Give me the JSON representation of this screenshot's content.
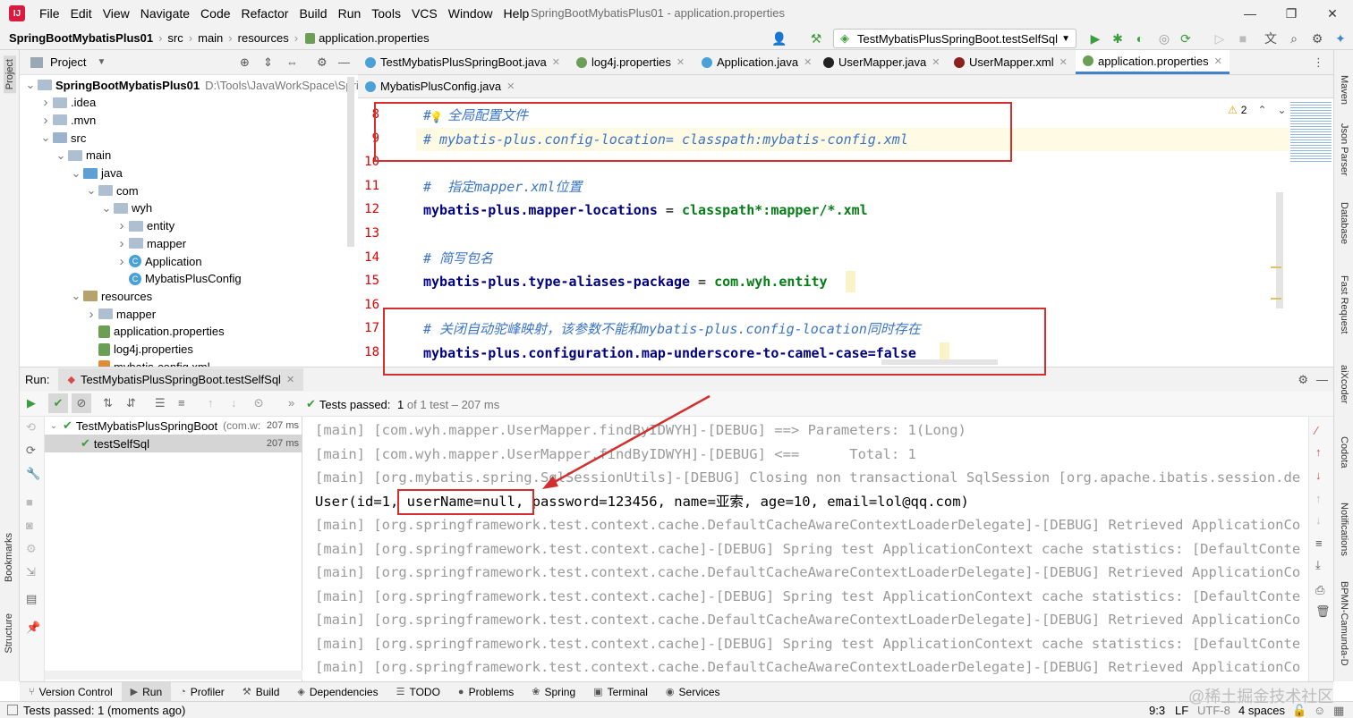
{
  "app": {
    "logo": "IJ",
    "window_title": "SpringBootMybatisPlus01 - application.properties",
    "menu": [
      "File",
      "Edit",
      "View",
      "Navigate",
      "Code",
      "Refactor",
      "Build",
      "Run",
      "Tools",
      "VCS",
      "Window",
      "Help"
    ]
  },
  "breadcrumb": [
    "SpringBootMybatisPlus01",
    "src",
    "main",
    "resources",
    "application.properties"
  ],
  "run_config": "TestMybatisPlusSpringBoot.testSelfSql",
  "project_panel": {
    "title": "Project",
    "tree": [
      {
        "label": "SpringBootMybatisPlus01",
        "extra": "D:\\Tools\\JavaWorkSpace\\Sprin",
        "type": "module",
        "depth": 0,
        "arrow": "down"
      },
      {
        "label": ".idea",
        "type": "folder",
        "depth": 1,
        "arrow": "right"
      },
      {
        "label": ".mvn",
        "type": "folder",
        "depth": 1,
        "arrow": "right"
      },
      {
        "label": "src",
        "type": "src",
        "depth": 1,
        "arrow": "down"
      },
      {
        "label": "main",
        "type": "folder",
        "depth": 2,
        "arrow": "down"
      },
      {
        "label": "java",
        "type": "java",
        "depth": 3,
        "arrow": "down"
      },
      {
        "label": "com",
        "type": "folder",
        "depth": 4,
        "arrow": "down"
      },
      {
        "label": "wyh",
        "type": "folder",
        "depth": 5,
        "arrow": "down"
      },
      {
        "label": "entity",
        "type": "folder",
        "depth": 6,
        "arrow": "right"
      },
      {
        "label": "mapper",
        "type": "folder",
        "depth": 6,
        "arrow": "right"
      },
      {
        "label": "Application",
        "type": "class",
        "depth": 6,
        "arrow": "right"
      },
      {
        "label": "MybatisPlusConfig",
        "type": "class",
        "depth": 6,
        "arrow": ""
      },
      {
        "label": "resources",
        "type": "res",
        "depth": 3,
        "arrow": "down"
      },
      {
        "label": "mapper",
        "type": "folder",
        "depth": 4,
        "arrow": "right"
      },
      {
        "label": "application.properties",
        "type": "prop",
        "depth": 4,
        "arrow": ""
      },
      {
        "label": "log4j.properties",
        "type": "prop",
        "depth": 4,
        "arrow": ""
      },
      {
        "label": "mybatis-config.xml",
        "type": "xml",
        "depth": 4,
        "arrow": ""
      }
    ]
  },
  "editor_tabs_row1": [
    "TestMybatisPlusSpringBoot.java",
    "log4j.properties",
    "Application.java",
    "UserMapper.java",
    "UserMapper.xml",
    "application.properties"
  ],
  "editor_tabs_row2": [
    "MybatisPlusConfig.java"
  ],
  "editor": {
    "warning_count": "2",
    "lines": [
      {
        "no": "8",
        "parts": [
          {
            "t": "#  全局配置文件",
            "c": "cm"
          }
        ]
      },
      {
        "no": "9",
        "parts": [
          {
            "t": "# mybatis-plus.config-location= classpath:mybatis-config.xml",
            "c": "cm"
          }
        ]
      },
      {
        "no": "10",
        "parts": []
      },
      {
        "no": "11",
        "parts": [
          {
            "t": "#  指定mapper.xml位置",
            "c": "cm"
          }
        ]
      },
      {
        "no": "12",
        "parts": [
          {
            "t": "mybatis-plus.mapper-locations",
            "c": "key"
          },
          {
            "t": " = ",
            "c": ""
          },
          {
            "t": "classpath*:mapper/*.xml",
            "c": "val"
          }
        ]
      },
      {
        "no": "13",
        "parts": []
      },
      {
        "no": "14",
        "parts": [
          {
            "t": "# 简写包名",
            "c": "cm"
          }
        ]
      },
      {
        "no": "15",
        "parts": [
          {
            "t": "mybatis-plus.type-aliases-package",
            "c": "key"
          },
          {
            "t": " = ",
            "c": ""
          },
          {
            "t": "com.wyh.entity",
            "c": "val"
          }
        ]
      },
      {
        "no": "16",
        "parts": []
      },
      {
        "no": "17",
        "parts": [
          {
            "t": "# 关闭自动驼峰映射，该参数不能和mybatis-plus.config-location同时存在",
            "c": "cm"
          }
        ]
      },
      {
        "no": "18",
        "parts": [
          {
            "t": "mybatis-plus.configuration.map-underscore-to-camel-case=false",
            "c": "key"
          }
        ]
      }
    ]
  },
  "run_panel": {
    "label": "Run:",
    "tab": "TestMybatisPlusSpringBoot.testSelfSql",
    "status_prefix": "Tests passed: ",
    "status_count": "1",
    "status_suffix": " of 1 test – 207 ms",
    "tests": [
      {
        "name": "TestMybatisPlusSpringBoot",
        "extra": "(com.w:",
        "time": "207 ms"
      },
      {
        "name": "testSelfSql",
        "extra": "",
        "time": "207 ms"
      }
    ],
    "console": [
      {
        "t": "[main] [com.wyh.mapper.UserMapper.findByIDWYH]-[DEBUG] ==> Parameters: 1(Long)",
        "out": false
      },
      {
        "t": "[main] [com.wyh.mapper.UserMapper.findByIDWYH]-[DEBUG] <==      Total: 1",
        "out": false
      },
      {
        "t": "[main] [org.mybatis.spring.SqlSessionUtils]-[DEBUG] Closing non transactional SqlSession [org.apache.ibatis.session.de",
        "out": false
      },
      {
        "t": "User(id=1, userName=null, password=123456, name=亚索, age=10, email=lol@qq.com)",
        "out": true
      },
      {
        "t": "[main] [org.springframework.test.context.cache.DefaultCacheAwareContextLoaderDelegate]-[DEBUG] Retrieved ApplicationCo",
        "out": false
      },
      {
        "t": "[main] [org.springframework.test.context.cache]-[DEBUG] Spring test ApplicationContext cache statistics: [DefaultConte",
        "out": false
      },
      {
        "t": "[main] [org.springframework.test.context.cache.DefaultCacheAwareContextLoaderDelegate]-[DEBUG] Retrieved ApplicationCo",
        "out": false
      },
      {
        "t": "[main] [org.springframework.test.context.cache]-[DEBUG] Spring test ApplicationContext cache statistics: [DefaultConte",
        "out": false
      },
      {
        "t": "[main] [org.springframework.test.context.cache.DefaultCacheAwareContextLoaderDelegate]-[DEBUG] Retrieved ApplicationCo",
        "out": false
      },
      {
        "t": "[main] [org.springframework.test.context.cache]-[DEBUG] Spring test ApplicationContext cache statistics: [DefaultConte",
        "out": false
      },
      {
        "t": "[main] [org.springframework.test.context.cache.DefaultCacheAwareContextLoaderDelegate]-[DEBUG] Retrieved ApplicationCo",
        "out": false
      }
    ]
  },
  "bottom_tabs": [
    "Version Control",
    "Run",
    "Profiler",
    "Build",
    "Dependencies",
    "TODO",
    "Problems",
    "Spring",
    "Terminal",
    "Services"
  ],
  "left_strip": [
    "Project",
    "Bookmarks",
    "Structure"
  ],
  "right_strip": [
    "Maven",
    "Json Parser",
    "Database",
    "Fast Request",
    "aiXcoder",
    "Codota",
    "Notifications",
    "BPMN-Camunda-D"
  ],
  "status_bar": {
    "message": "Tests passed: 1 (moments ago)",
    "position": "9:3",
    "line_sep": "LF",
    "encoding": "UTF-8",
    "indent": "4 spaces",
    "watermark": "@稀土掘金技术社区"
  },
  "colors": {
    "accent": "#4083c9",
    "annotation": "#d32f2f",
    "pass": "#3d9c3d",
    "comment": "#3a74c8",
    "key": "#000080",
    "value": "#067d17"
  }
}
